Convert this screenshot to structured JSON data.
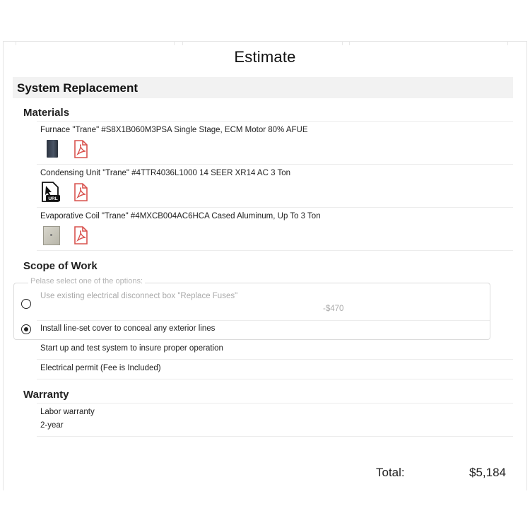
{
  "page": {
    "title": "Estimate"
  },
  "section": {
    "title": "System Replacement"
  },
  "materials": {
    "heading": "Materials",
    "items": [
      {
        "text": "Furnace \"Trane\" #S8X1B060M3PSA Single Stage, ECM Motor 80% AFUE",
        "icons": [
          "furnace-thumbnail",
          "pdf-icon"
        ]
      },
      {
        "text": "Condensing Unit \"Trane\" #4TTR4036L1000 14 SEER XR14 AC 3 Ton",
        "icons": [
          "url-link-icon",
          "pdf-icon"
        ]
      },
      {
        "text": "Evaporative Coil \"Trane\" #4MXCB004AC6HCA Cased Aluminum, Up To 3 Ton",
        "icons": [
          "coil-thumbnail",
          "pdf-icon"
        ]
      }
    ],
    "url_icon_label": "URL"
  },
  "scope": {
    "heading": "Scope of Work",
    "option_prompt": "Pelase select one of the options:",
    "options": [
      {
        "text": "Use existing electrical disconnect box \"Replace Fuses\"",
        "price": "-$470",
        "selected": false
      },
      {
        "text": "Install line-set cover to conceal any exterior lines",
        "price": "",
        "selected": true
      }
    ],
    "items": [
      "Start up and test system to insure proper operation",
      "Electrical permit (Fee is Included)"
    ]
  },
  "warranty": {
    "heading": "Warranty",
    "label": "Labor warranty",
    "value": "2-year"
  },
  "total": {
    "label": "Total:",
    "value": "$5,184"
  },
  "colors": {
    "pdf_red": "#d9534f",
    "selected_radio": "#222222",
    "section_bar": "#f2f2f2"
  }
}
